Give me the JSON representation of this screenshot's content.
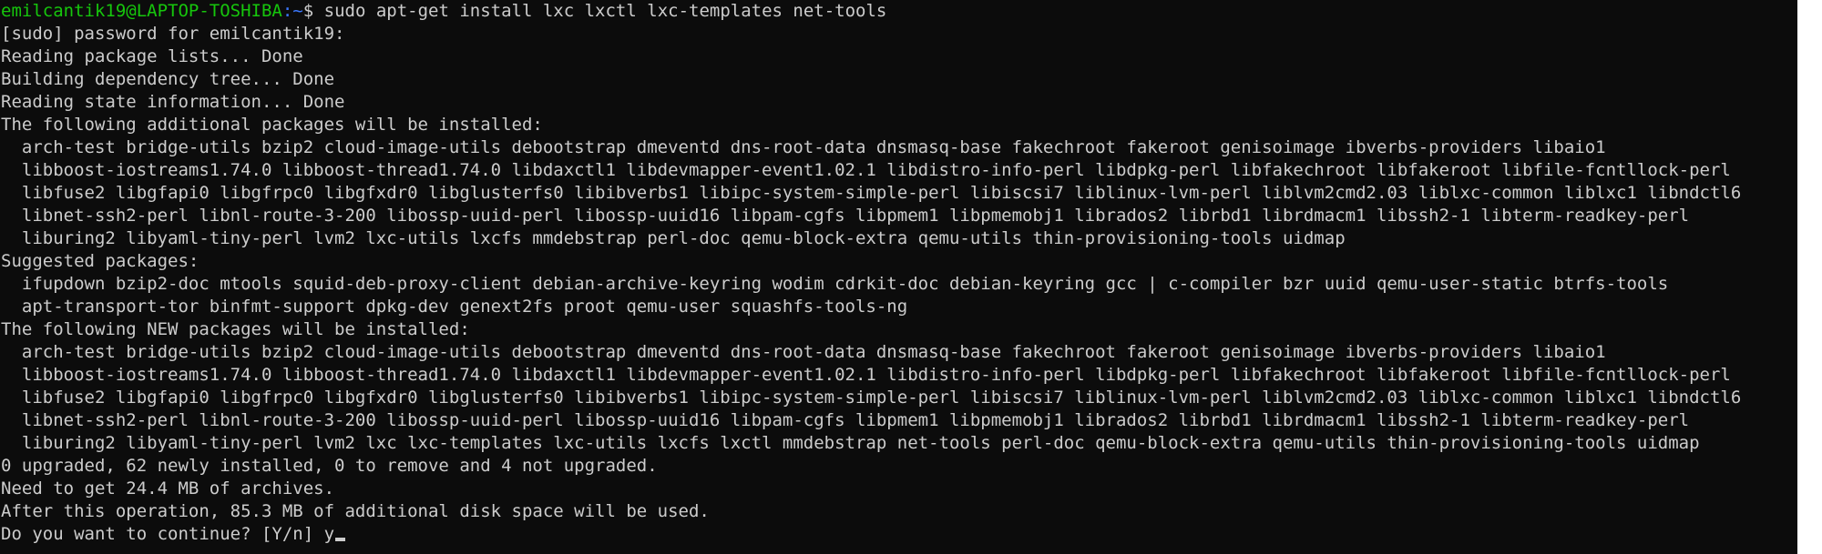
{
  "prompt": {
    "user_host": "emilcantik19@LAPTOP-TOSHIBA",
    "path": ":~",
    "symbol": "$ ",
    "command": "sudo apt-get install lxc lxctl lxc-templates net-tools"
  },
  "output_lines": [
    "[sudo] password for emilcantik19:",
    "Reading package lists... Done",
    "Building dependency tree... Done",
    "Reading state information... Done",
    "The following additional packages will be installed:",
    "  arch-test bridge-utils bzip2 cloud-image-utils debootstrap dmeventd dns-root-data dnsmasq-base fakechroot fakeroot genisoimage ibverbs-providers libaio1",
    "  libboost-iostreams1.74.0 libboost-thread1.74.0 libdaxctl1 libdevmapper-event1.02.1 libdistro-info-perl libdpkg-perl libfakechroot libfakeroot libfile-fcntllock-perl",
    "  libfuse2 libgfapi0 libgfrpc0 libgfxdr0 libglusterfs0 libibverbs1 libipc-system-simple-perl libiscsi7 liblinux-lvm-perl liblvm2cmd2.03 liblxc-common liblxc1 libndctl6",
    "  libnet-ssh2-perl libnl-route-3-200 libossp-uuid-perl libossp-uuid16 libpam-cgfs libpmem1 libpmemobj1 librados2 librbd1 librdmacm1 libssh2-1 libterm-readkey-perl",
    "  liburing2 libyaml-tiny-perl lvm2 lxc-utils lxcfs mmdebstrap perl-doc qemu-block-extra qemu-utils thin-provisioning-tools uidmap",
    "Suggested packages:",
    "  ifupdown bzip2-doc mtools squid-deb-proxy-client debian-archive-keyring wodim cdrkit-doc debian-keyring gcc | c-compiler bzr uuid qemu-user-static btrfs-tools",
    "  apt-transport-tor binfmt-support dpkg-dev genext2fs proot qemu-user squashfs-tools-ng",
    "The following NEW packages will be installed:",
    "  arch-test bridge-utils bzip2 cloud-image-utils debootstrap dmeventd dns-root-data dnsmasq-base fakechroot fakeroot genisoimage ibverbs-providers libaio1",
    "  libboost-iostreams1.74.0 libboost-thread1.74.0 libdaxctl1 libdevmapper-event1.02.1 libdistro-info-perl libdpkg-perl libfakechroot libfakeroot libfile-fcntllock-perl",
    "  libfuse2 libgfapi0 libgfrpc0 libgfxdr0 libglusterfs0 libibverbs1 libipc-system-simple-perl libiscsi7 liblinux-lvm-perl liblvm2cmd2.03 liblxc-common liblxc1 libndctl6",
    "  libnet-ssh2-perl libnl-route-3-200 libossp-uuid-perl libossp-uuid16 libpam-cgfs libpmem1 libpmemobj1 librados2 librbd1 librdmacm1 libssh2-1 libterm-readkey-perl",
    "  liburing2 libyaml-tiny-perl lvm2 lxc lxc-templates lxc-utils lxcfs lxctl mmdebstrap net-tools perl-doc qemu-block-extra qemu-utils thin-provisioning-tools uidmap",
    "0 upgraded, 62 newly installed, 0 to remove and 4 not upgraded.",
    "Need to get 24.4 MB of archives.",
    "After this operation, 85.3 MB of additional disk space will be used."
  ],
  "final_prompt": {
    "question": "Do you want to continue? [Y/n] ",
    "input_value": "y"
  },
  "colors": {
    "background": "#0c0c0c",
    "foreground": "#cccccc",
    "user_host": "#16c60c",
    "path": "#3b78ff"
  }
}
